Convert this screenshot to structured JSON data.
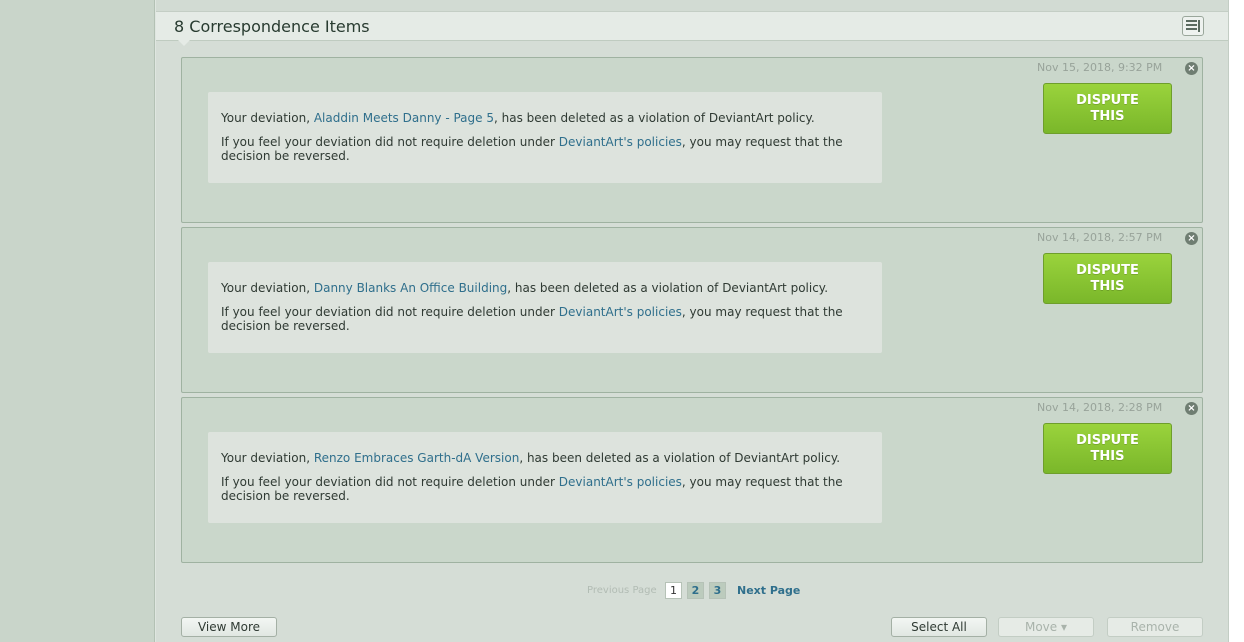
{
  "header": {
    "title": "8 Correspondence Items",
    "list_icon": "list-icon"
  },
  "items": [
    {
      "timestamp": "Nov 15, 2018, 9:32 PM",
      "line_prefix": "Your deviation, ",
      "deviation_title": "Aladdin Meets Danny - Page 5",
      "line_suffix": ", has been deleted as a violation of DeviantArt policy.",
      "p2_prefix": "If you feel your deviation did not require deletion under ",
      "policy_link": "DeviantArt's policies",
      "p2_suffix": ", you may request that the decision be reversed.",
      "dispute_label_1": "DISPUTE",
      "dispute_label_2": "THIS"
    },
    {
      "timestamp": "Nov 14, 2018, 2:57 PM",
      "line_prefix": "Your deviation, ",
      "deviation_title": "Danny Blanks An Office Building",
      "line_suffix": ", has been deleted as a violation of DeviantArt policy.",
      "p2_prefix": "If you feel your deviation did not require deletion under ",
      "policy_link": "DeviantArt's policies",
      "p2_suffix": ", you may request that the decision be reversed.",
      "dispute_label_1": "DISPUTE",
      "dispute_label_2": "THIS"
    },
    {
      "timestamp": "Nov 14, 2018, 2:28 PM",
      "line_prefix": "Your deviation, ",
      "deviation_title": "Renzo Embraces Garth-dA Version",
      "line_suffix": ", has been deleted as a violation of DeviantArt policy.",
      "p2_prefix": "If you feel your deviation did not require deletion under ",
      "policy_link": "DeviantArt's policies",
      "p2_suffix": ", you may request that the decision be reversed.",
      "dispute_label_1": "DISPUTE",
      "dispute_label_2": "THIS"
    }
  ],
  "pager": {
    "prev_label": "Previous Page",
    "pages": [
      "1",
      "2",
      "3"
    ],
    "current_page": "1",
    "next_label": "Next Page"
  },
  "footer": {
    "view_more": "View More",
    "select_all": "Select All",
    "move": "Move ▾",
    "remove": "Remove"
  },
  "colors": {
    "dispute_green": "#8cc63f",
    "link_blue": "#2f6f8c",
    "card_bg": "#cad7cb"
  }
}
